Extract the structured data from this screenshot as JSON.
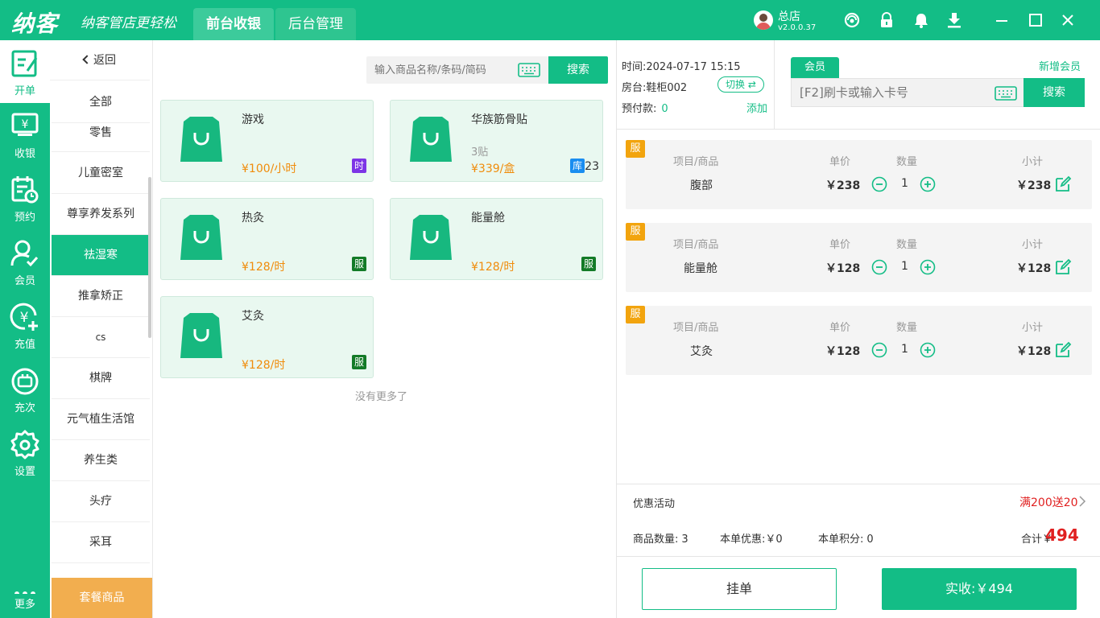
{
  "app": {
    "logo": "纳客",
    "slogan": "纳客管店更轻松",
    "tabs": [
      "前台收银",
      "后台管理"
    ],
    "user_name": "总店",
    "version": "v2.0.0.37"
  },
  "colors": {
    "brand": "#13bd86",
    "price": "#f08c0b",
    "accent_red": "#e02020",
    "service_tag": "#f2a40e",
    "package": "#f2ae4f"
  },
  "left_nav": [
    {
      "label": "开单",
      "icon": "order-edit-icon"
    },
    {
      "label": "收银",
      "icon": "cash-register-icon"
    },
    {
      "label": "预约",
      "icon": "calendar-clock-icon"
    },
    {
      "label": "会员",
      "icon": "member-check-icon"
    },
    {
      "label": "充值",
      "icon": "yen-plus-icon"
    },
    {
      "label": "充次",
      "icon": "count-card-icon"
    },
    {
      "label": "设置",
      "icon": "gear-icon"
    },
    {
      "label": "更多",
      "icon": "more-dots-icon"
    }
  ],
  "categories": {
    "back_label": "返回",
    "items": [
      "全部",
      "零售",
      "儿童密室",
      "尊享养发系列",
      "祛湿寒",
      "推拿矫正",
      "cs",
      "棋牌",
      "元气植生活馆",
      "养生类",
      "头疗",
      "采耳"
    ],
    "active": "祛湿寒",
    "package_label": "套餐商品"
  },
  "product_search": {
    "placeholder": "输入商品名称/条码/简码",
    "button": "搜索"
  },
  "products": [
    {
      "name": "游戏",
      "spec": "",
      "price": "¥100/小时",
      "badge": "时"
    },
    {
      "name": "华族筋骨贴",
      "spec": "3贴",
      "price": "¥339/盒",
      "badge": "库",
      "stock": "23"
    },
    {
      "name": "热灸",
      "spec": "",
      "price": "¥128/时",
      "badge": "服"
    },
    {
      "name": "能量舱",
      "spec": "",
      "price": "¥128/时",
      "badge": "服"
    },
    {
      "name": "艾灸",
      "spec": "",
      "price": "¥128/时",
      "badge": "服"
    }
  ],
  "no_more": "没有更多了",
  "order_info": {
    "time_label": "时间:",
    "time_value": "2024-07-17 15:15",
    "room_label": "房台:",
    "room_value": "鞋柜002",
    "switch_label": "切换",
    "prepay_label": "预付款:",
    "prepay_value": "0",
    "add_label": "添加"
  },
  "member": {
    "tab": "会员",
    "new_member": "新增会员",
    "placeholder": "[F2]刷卡或输入卡号",
    "button": "搜索"
  },
  "order_headers": {
    "item": "项目/商品",
    "price": "单价",
    "qty": "数量",
    "subtotal": "小计"
  },
  "order_items": [
    {
      "tag": "服",
      "name": "腹部",
      "price": "￥238",
      "qty": "1",
      "subtotal": "￥238"
    },
    {
      "tag": "服",
      "name": "能量舱",
      "price": "￥128",
      "qty": "1",
      "subtotal": "￥128"
    },
    {
      "tag": "服",
      "name": "艾灸",
      "price": "￥128",
      "qty": "1",
      "subtotal": "￥128"
    }
  ],
  "promo": {
    "label": "优惠活动",
    "value": "满200送20"
  },
  "summary": {
    "count_label": "商品数量:",
    "count_value": "3",
    "discount_label": "本单优惠:",
    "discount_value": "￥0",
    "points_label": "本单积分:",
    "points_value": "0",
    "total_label": "合计￥",
    "total_value": "494"
  },
  "actions": {
    "hang": "挂单",
    "pay": "实收:￥494"
  }
}
